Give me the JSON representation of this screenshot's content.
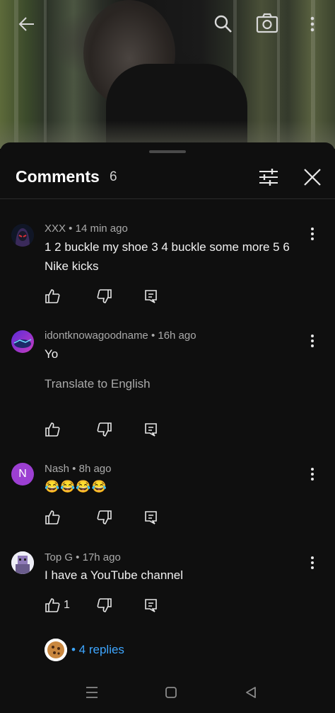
{
  "video": {
    "back_icon": "arrow-left-icon",
    "search_icon": "search-icon",
    "cast_icon": "camera-icon",
    "more_icon": "more-vertical-icon"
  },
  "header": {
    "title": "Comments",
    "count": "6",
    "filter_icon": "sliders-icon",
    "close_icon": "close-icon"
  },
  "comments": [
    {
      "meta": "XXX • 14 min ago",
      "text": "1 2 buckle my shoe 3 4 buckle some more 5 6 Nike kicks",
      "likes": "",
      "avatar": "hooded-avatar"
    },
    {
      "meta": "idontknowagoodname • 16h ago",
      "text": "Yo",
      "translate": "Translate to English",
      "likes": "",
      "avatar": "purple-scene-avatar"
    },
    {
      "meta": "Nash • 8h ago",
      "text": "😂😂😂😂",
      "likes": "",
      "avatar_letter": "N",
      "avatar_color": "#9c3fd2"
    },
    {
      "meta": "Top G • 17h ago",
      "text": "I have a YouTube channel",
      "likes": "1",
      "avatar": "pixel-avatar",
      "replies_label": "• 4 replies"
    }
  ],
  "colors": {
    "background": "#0f0f0f",
    "link": "#3ea6ff",
    "secondary_text": "#aaaaaa"
  }
}
